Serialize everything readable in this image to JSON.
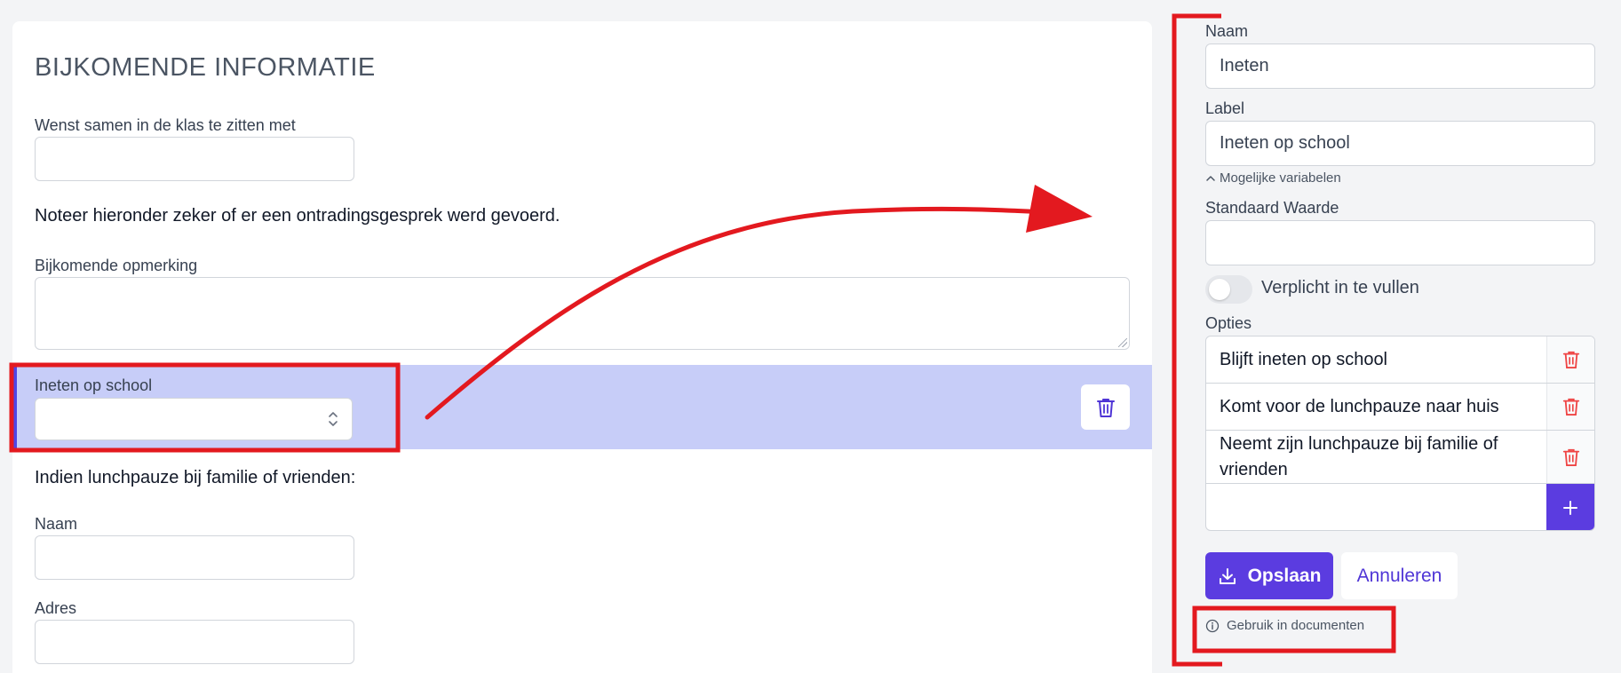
{
  "left": {
    "section_title": "BIJKOMENDE INFORMATIE",
    "field_together_label": "Wenst samen in de klas te zitten met",
    "note_text": "Noteer hieronder zeker of er een ontradingsgesprek werd gevoerd.",
    "remark_label": "Bijkomende opmerking",
    "lunch_label": "Ineten op school",
    "lunch_select_value": "",
    "family_heading": "Indien lunchpauze bij familie of vrienden:",
    "name_label": "Naam",
    "address_label": "Adres"
  },
  "right": {
    "name_label": "Naam",
    "name_value": "Ineten",
    "label_label": "Label",
    "label_value": "Ineten op school",
    "variables_hint": "Mogelijke variabelen",
    "default_label": "Standaard Waarde",
    "default_value": "",
    "required_label": "Verplicht in te vullen",
    "required_on": false,
    "options_label": "Opties",
    "options": [
      {
        "text": "Blijft ineten op school"
      },
      {
        "text": "Komt voor de lunchpauze naar huis"
      },
      {
        "text": "Neemt zijn lunchpauze bij familie of vrienden"
      }
    ],
    "new_option_value": "",
    "save_label": "Opslaan",
    "cancel_label": "Annuleren",
    "documents_link": "Gebruik in documenten"
  },
  "colors": {
    "accent": "#5b3ce0",
    "highlight": "#c7cdf8",
    "danger": "#ef4444",
    "annotation": "#e3191f"
  }
}
